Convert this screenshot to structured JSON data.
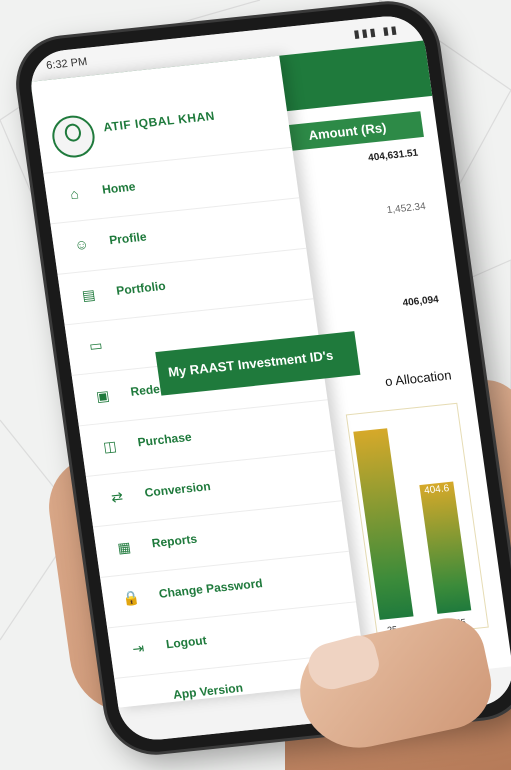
{
  "status_bar": {
    "time": "6:32 PM",
    "signal": "▮▮▮ ▮▮"
  },
  "table": {
    "amount_header": "Amount (Rs)",
    "values": [
      "404,631.51",
      "1,452.34",
      "406,094"
    ]
  },
  "allocation_label": "o Allocation",
  "chart": {
    "bar_label": "404.6",
    "ticks": [
      "25",
      "Jun 25"
    ]
  },
  "drawer": {
    "user_name": "ATIF IQBAL KHAN",
    "highlight_label": "My RAAST Investment ID's",
    "items": [
      {
        "label": "Home",
        "icon": "home-icon"
      },
      {
        "label": "Profile",
        "icon": "profile-icon"
      },
      {
        "label": "Portfolio",
        "icon": "portfolio-icon"
      },
      {
        "label": "",
        "icon": "id-card-icon"
      },
      {
        "label": "Redemption",
        "icon": "redemption-icon"
      },
      {
        "label": "Purchase",
        "icon": "purchase-icon"
      },
      {
        "label": "Conversion",
        "icon": "conversion-icon"
      },
      {
        "label": "Reports",
        "icon": "reports-icon"
      },
      {
        "label": "Change Password",
        "icon": "lock-icon"
      },
      {
        "label": "Logout",
        "icon": "logout-icon"
      },
      {
        "label": "App Version",
        "icon": ""
      }
    ]
  },
  "colors": {
    "brand_green": "#1f7a3c",
    "chart_gold": "#d6a92a"
  }
}
